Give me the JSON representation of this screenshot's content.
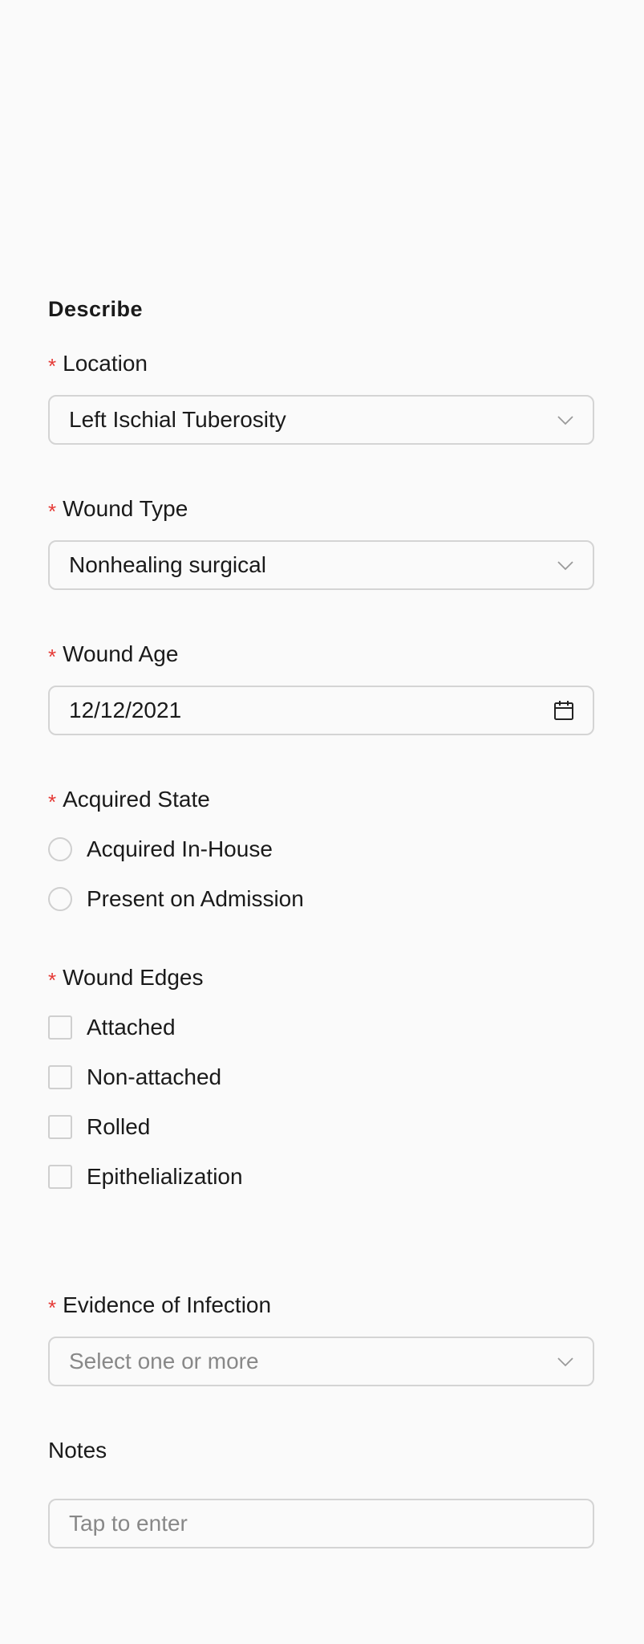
{
  "section": {
    "title": "Describe"
  },
  "location": {
    "label": "Location",
    "value": "Left Ischial Tuberosity",
    "icon": "chevron-down-icon"
  },
  "wound_type": {
    "label": "Wound Type",
    "value": "Nonhealing surgical",
    "icon": "chevron-down-icon"
  },
  "wound_age": {
    "label": "Wound Age",
    "value": "12/12/2021",
    "icon": "calendar-icon"
  },
  "acquired_state": {
    "label": "Acquired State",
    "options": [
      {
        "label": "Acquired In-House",
        "selected": false
      },
      {
        "label": "Present on Admission",
        "selected": false
      }
    ]
  },
  "wound_edges": {
    "label": "Wound Edges",
    "options": [
      {
        "label": "Attached",
        "checked": false
      },
      {
        "label": "Non-attached",
        "checked": false
      },
      {
        "label": "Rolled",
        "checked": false
      },
      {
        "label": "Epithelialization",
        "checked": false
      }
    ]
  },
  "evidence_of_infection": {
    "label": "Evidence of Infection",
    "placeholder": "Select one or more",
    "icon": "chevron-down-icon"
  },
  "notes": {
    "label": "Notes",
    "placeholder": "Tap to enter"
  },
  "colors": {
    "required": "#e53935",
    "border": "#d4d4d4",
    "placeholder": "#888888",
    "background": "#fafafa"
  },
  "required_marker": "*"
}
